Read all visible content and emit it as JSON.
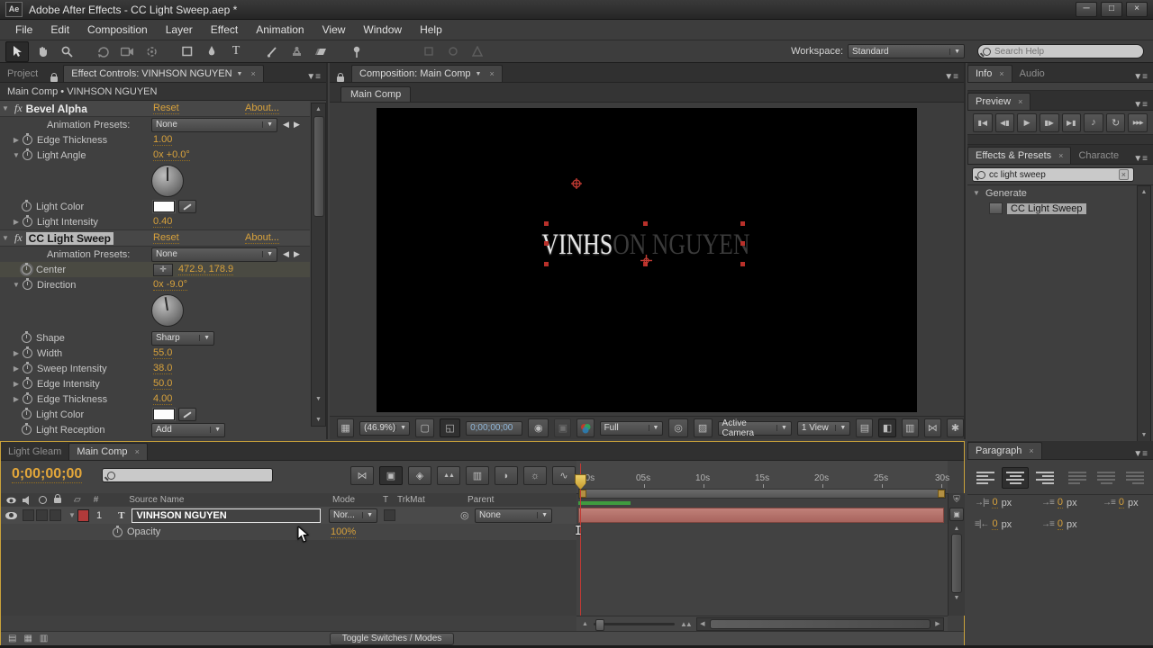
{
  "titlebar": {
    "logo": "Ae",
    "title": "Adobe After Effects - CC Light Sweep.aep *"
  },
  "menubar": {
    "items": [
      "File",
      "Edit",
      "Composition",
      "Layer",
      "Effect",
      "Animation",
      "View",
      "Window",
      "Help"
    ]
  },
  "toolbar": {
    "workspace_label": "Workspace:",
    "workspace_value": "Standard",
    "search_placeholder": "Search Help"
  },
  "icons": {
    "panel_menu": "▼≡",
    "twirl_open": "▼",
    "twirl_closed": "▶",
    "dropdown_arrow": "▼",
    "nav_left": "◀",
    "nav_right": "▶",
    "close": "×",
    "minimize": "─",
    "maximize": "□",
    "scroll_up": "▲",
    "scroll_down": "▼",
    "scroll_left": "◀",
    "scroll_right": "▶",
    "mini_flowchart": "⋈",
    "live_update": "▣",
    "draft_3d": "◈",
    "frame_blend": "▲▲",
    "motion_blur": "▥",
    "adjustment": "◗",
    "brainstorm": "☼",
    "graph_editor": "∿",
    "first_frame": "▮◀",
    "prev_frame": "◀▮",
    "play": "▶",
    "next_frame": "▮▶",
    "last_frame": "▶▮",
    "audio": "♪",
    "loop": "↻",
    "ram_preview": "▶▶▶",
    "zoom_out_mountain": "▲",
    "zoom_in_mountain": "▲▲",
    "footer_1": "▤",
    "footer_2": "▦",
    "footer_3": "▥",
    "comp_grid": "▦",
    "comp_safe": "▢",
    "comp_roi": "◱",
    "comp_camera": "◉",
    "comp_snapshot": "▣",
    "comp_target": "◎",
    "comp_checker": "▨",
    "comp_guides": "▤",
    "comp_exposure": "◧",
    "comp_histogram": "▥",
    "comp_flowchart": "⋈",
    "comp_blur": "✱",
    "shield": "⛨",
    "pick_whip": "◎",
    "hash": "#",
    "label_tag": "▱"
  },
  "effect_controls": {
    "tab_project": "Project",
    "tab_title": "Effect Controls: VINHSON NGUYEN",
    "breadcrumb": "Main Comp • VINHSON NGUYEN",
    "bevel_alpha": {
      "name": "Bevel Alpha",
      "reset": "Reset",
      "about": "About...",
      "presets_label": "Animation Presets:",
      "presets_value": "None",
      "edge_thickness_label": "Edge Thickness",
      "edge_thickness_value": "1.00",
      "light_angle_label": "Light Angle",
      "light_angle_value": "0x +0.0°",
      "light_color_label": "Light Color",
      "light_intensity_label": "Light Intensity",
      "light_intensity_value": "0.40"
    },
    "cc_light_sweep": {
      "name": "CC Light Sweep",
      "reset": "Reset",
      "about": "About...",
      "presets_label": "Animation Presets:",
      "presets_value": "None",
      "center_label": "Center",
      "center_value": "472.9, 178.9",
      "direction_label": "Direction",
      "direction_value": "0x -9.0°",
      "shape_label": "Shape",
      "shape_value": "Sharp",
      "width_label": "Width",
      "width_value": "55.0",
      "sweep_intensity_label": "Sweep Intensity",
      "sweep_intensity_value": "38.0",
      "edge_intensity_label": "Edge Intensity",
      "edge_intensity_value": "50.0",
      "edge_thickness_label": "Edge Thickness",
      "edge_thickness_value": "4.00",
      "light_color_label": "Light Color",
      "light_reception_label": "Light Reception",
      "light_reception_value": "Add"
    }
  },
  "composition": {
    "tab_title": "Composition: Main Comp",
    "nav_tab": "Main Comp",
    "canvas_text_bright": "VINHS",
    "canvas_text_dim": "ON NGUYEN",
    "toolbar": {
      "zoom": "(46.9%)",
      "timecode": "0;00;00;00",
      "resolution": "Full",
      "camera": "Active Camera",
      "view": "1 View"
    }
  },
  "right_panels": {
    "info_tab": "Info",
    "audio_tab": "Audio",
    "preview_tab": "Preview",
    "effects_presets_tab": "Effects & Presets",
    "character_tab": "Characte",
    "search_value": "cc light sweep",
    "category": "Generate",
    "preset": "CC Light Sweep"
  },
  "paragraph": {
    "tab": "Paragraph",
    "px": "px",
    "indent_values": [
      "0",
      "0",
      "0",
      "0",
      "0"
    ]
  },
  "timeline": {
    "tab_inactive": "Light Gleam",
    "tab_active": "Main Comp",
    "timecode": "0;00;00;00",
    "columns": {
      "source_name": "Source Name",
      "mode": "Mode",
      "t": "T",
      "trkmat": "TrkMat",
      "parent": "Parent"
    },
    "layer": {
      "number": "1",
      "type": "T",
      "name": "VINHSON NGUYEN",
      "mode": "Nor...",
      "parent": "None"
    },
    "opacity_label": "Opacity",
    "opacity_value": "100%",
    "ruler_ticks": [
      "00s",
      "05s",
      "10s",
      "15s",
      "20s",
      "25s",
      "30s"
    ],
    "toggle_button": "Toggle Switches / Modes"
  }
}
